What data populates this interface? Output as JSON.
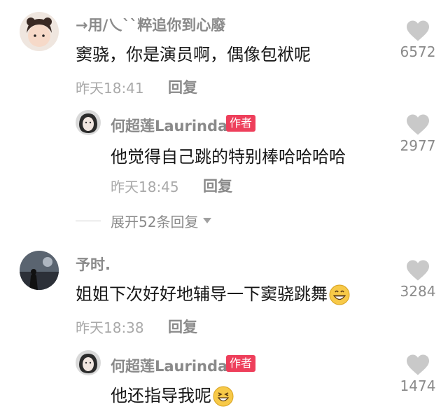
{
  "comments": [
    {
      "username": "→用/乀``粹追你到心廢",
      "text": "窦骁，你是演员啊，偶像包袱呢",
      "time": "昨天18:41",
      "reply_label": "回复",
      "likes": "6572",
      "replies": [
        {
          "username": "何超莲Laurinda",
          "badge": "作者",
          "text": "他觉得自己跳的特别棒哈哈哈哈",
          "time": "昨天18:45",
          "reply_label": "回复",
          "likes": "2977"
        }
      ],
      "expand_label": "展开52条回复"
    },
    {
      "username": "予时.",
      "text": "姐姐下次好好地辅导一下窦骁跳舞",
      "emoji": "grin-emoji",
      "time": "昨天18:38",
      "reply_label": "回复",
      "likes": "3284",
      "replies": [
        {
          "username": "何超莲Laurinda",
          "badge": "作者",
          "text": "他还指导我呢",
          "emoji": "laughing-squint-emoji",
          "likes": "1474"
        }
      ]
    }
  ],
  "icons": {
    "like": "heart-icon",
    "expand": "caret-down-icon"
  },
  "colors": {
    "badge": "#ee3f5b",
    "muted": "#8a8a8a",
    "heart": "#c9c9c9"
  }
}
